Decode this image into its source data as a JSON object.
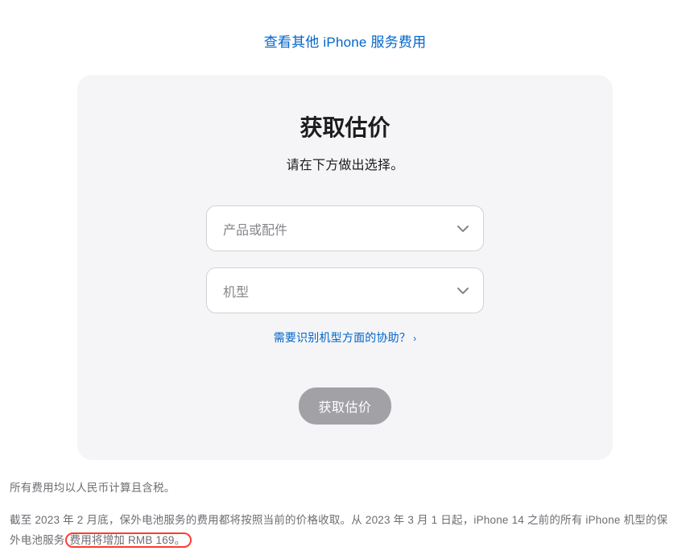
{
  "topLink": {
    "label": "查看其他 iPhone 服务费用"
  },
  "card": {
    "title": "获取估价",
    "subtitle": "请在下方做出选择。",
    "select1": {
      "placeholder": "产品或配件"
    },
    "select2": {
      "placeholder": "机型"
    },
    "helpLink": {
      "label": "需要识别机型方面的协助？"
    },
    "submitButton": {
      "label": "获取估价"
    }
  },
  "footer": {
    "note1": "所有费用均以人民币计算且含税。",
    "note2_part1": "截至 2023 年 2 月底，保外电池服务的费用都将按照当前的价格收取。从 2023 年 3 月 1 日起，iPhone 14 之前的所有 iPhone 机型的保外电池服务",
    "note2_highlight": "费用将增加 RMB 169。"
  }
}
